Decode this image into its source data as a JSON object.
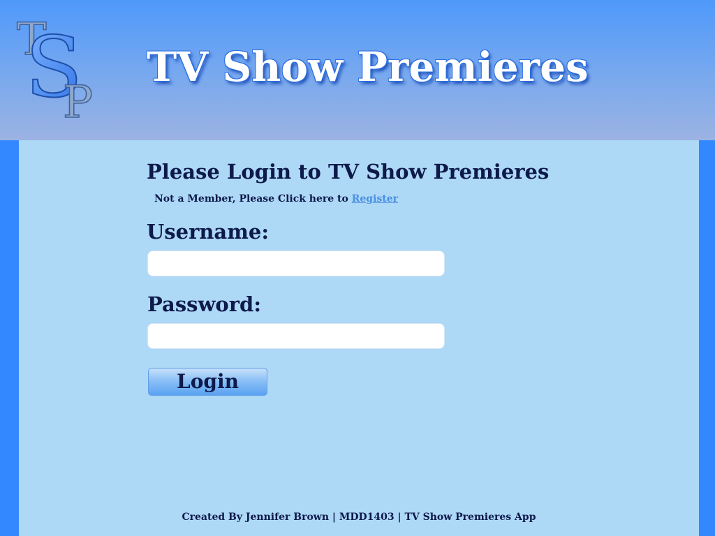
{
  "header": {
    "logo_letters": [
      "T",
      "S",
      "P"
    ],
    "title": "TV Show Premieres"
  },
  "login": {
    "heading": "Please Login to TV Show Premieres",
    "register_prompt": "Not a Member, Please Click here to",
    "register_link": "Register",
    "username_label": "Username:",
    "username_value": "",
    "password_label": "Password:",
    "password_value": "",
    "login_button": "Login"
  },
  "footer": {
    "text": "Created By Jennifer Brown | MDD1403 | TV Show Premieres App"
  },
  "colors": {
    "page_background": "#3388ff",
    "header_top": "#4f99fb",
    "header_bottom": "#9cb3e2",
    "content_background": "#add8f6",
    "text": "#0d1a4a",
    "link": "#4a90e2"
  }
}
